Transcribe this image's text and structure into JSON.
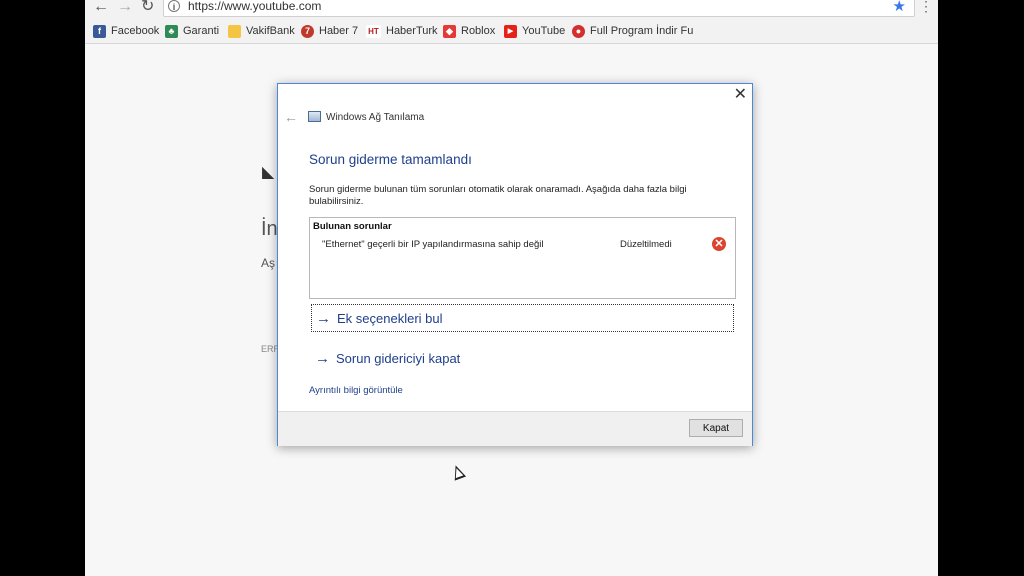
{
  "browser": {
    "url": "https://www.youtube.com",
    "bookmarks": [
      {
        "label": "Facebook",
        "icon": "facebook-icon",
        "glyph": "f",
        "color": "#3b5998"
      },
      {
        "label": "Garanti",
        "icon": "garanti-icon",
        "glyph": "♣",
        "color": "#2e8b57"
      },
      {
        "label": "VakifBank",
        "icon": "folder-icon",
        "glyph": "",
        "color": "#f4c542"
      },
      {
        "label": "Haber 7",
        "icon": "haber7-icon",
        "glyph": "7",
        "color": "#c0392b"
      },
      {
        "label": "HaberTurk",
        "icon": "haberturk-icon",
        "glyph": "HT",
        "color": "#b71c1c"
      },
      {
        "label": "Roblox",
        "icon": "roblox-icon",
        "glyph": "◆",
        "color": "#e53935"
      },
      {
        "label": "YouTube",
        "icon": "youtube-icon",
        "glyph": "▶",
        "color": "#e62117"
      },
      {
        "label": "Full Program İndir Fu",
        "icon": "program-icon",
        "glyph": "●",
        "color": "#d32f2f"
      }
    ]
  },
  "background_page": {
    "line1": "İn",
    "line2": "Aş",
    "line3": "ERR"
  },
  "dialog": {
    "app_title": "Windows Ağ Tanılama",
    "heading": "Sorun giderme tamamlandı",
    "description": "Sorun giderme bulunan tüm sorunları otomatik olarak onaramadı. Aşağıda daha fazla bilgi bulabilirsiniz.",
    "problems_header": "Bulunan sorunlar",
    "problem_text": "\"Ethernet\" geçerli bir IP yapılandırmasına sahip değil",
    "problem_status": "Düzeltilmedi",
    "option1": "Ek seçenekleri bul",
    "option2": "Sorun gidericiyi kapat",
    "detail_link": "Ayrıntılı bilgi görüntüle",
    "close_button": "Kapat"
  }
}
